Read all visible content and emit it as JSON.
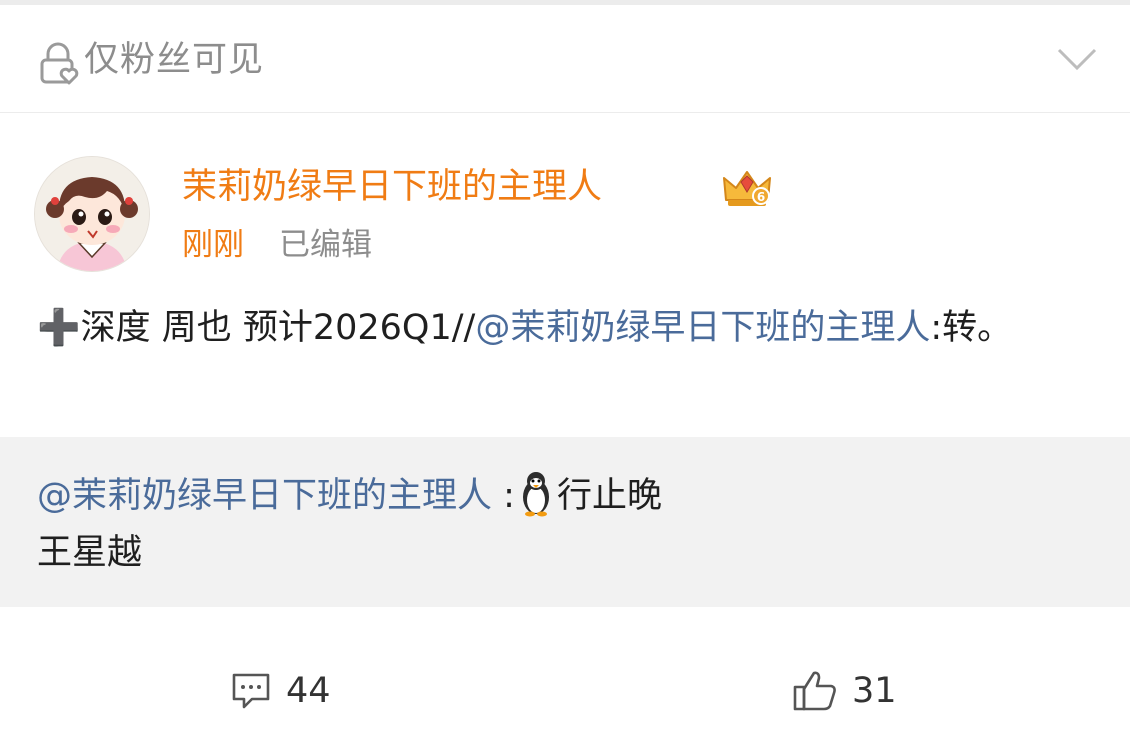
{
  "visibility": {
    "label": "仅粉丝可见",
    "icon": "lock-heart-icon",
    "expand_icon": "chevron-down-icon"
  },
  "author": {
    "name": "茉莉奶绿早日下班的主理人",
    "badge_icon": "crown-badge-icon",
    "avatar_icon": "cartoon-girl-avatar",
    "name_color": "#f07c14"
  },
  "meta": {
    "time": "刚刚",
    "edited": "已编辑"
  },
  "post": {
    "plus": "➕",
    "text_main": "深度 周也  预计2026Q1//",
    "mention": "@茉莉奶绿早日下班的主理人",
    "text_tail": ":转。",
    "mention_color": "#4a6b9a"
  },
  "quoted": {
    "mention": "@茉莉奶绿早日下班的主理人",
    "separator": " :",
    "emoji_icon": "penguin-emoji",
    "text_line1": "行止晚",
    "text_line2": "王星越"
  },
  "actions": {
    "comment_icon": "comment-icon",
    "comment_count": "44",
    "like_icon": "thumbs-up-icon",
    "like_count": "31"
  }
}
